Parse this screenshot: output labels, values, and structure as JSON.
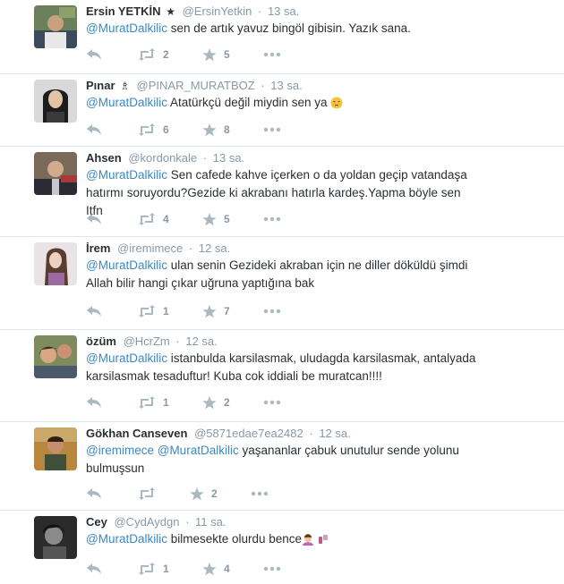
{
  "tweets": [
    {
      "name": "Ersin YETKİN",
      "badge": "★",
      "handle": "@ErsinYetkin",
      "time": "13 sa.",
      "mentions": [
        "@MuratDalkilic"
      ],
      "text": " sen de artık yavuz bingöl gibisin. Yazık sana.",
      "retweets": "2",
      "favorites": "5"
    },
    {
      "name": "Pınar",
      "badge": "♗",
      "handle": "@PINAR_MURATBOZ",
      "time": "13 sa.",
      "mentions": [
        "@MuratDalkilic"
      ],
      "text": " Atatürkçü değil miydin sen ya ",
      "emoji": "pensive-face-emoji",
      "retweets": "6",
      "favorites": "8"
    },
    {
      "name": "Ahsen",
      "handle": "@kordonkale",
      "time": "13 sa.",
      "mentions": [
        "@MuratDalkilic"
      ],
      "text": " Sen cafede kahve içerken o da yoldan geçip vatandaşa hatırmı soruyordu?Gezide ki akrabanı hatırla kardeş.Yapma böyle sen Itfn",
      "retweets": "4",
      "favorites": "5"
    },
    {
      "name": "İrem",
      "handle": "@iremimece",
      "time": "12 sa.",
      "mentions": [
        "@MuratDalkilic"
      ],
      "text": " ulan senin Gezideki akraban için ne diller döküldü şimdi Allah bilir hangi çıkar uğruna yaptığına bak",
      "retweets": "1",
      "favorites": "7"
    },
    {
      "name": "özüm",
      "handle": "@HcrZm",
      "time": "12 sa.",
      "mentions": [
        "@MuratDalkilic"
      ],
      "text": " istanbulda karsilasmak, uludagda karsilasmak, antalyada karsilasmak tesaduftur! Kuba cok iddiali be muratcan!!!!",
      "retweets": "1",
      "favorites": "2"
    },
    {
      "name": "Gökhan Canseven",
      "handle": "@5871edae7ea2482",
      "time": "12 sa.",
      "mentions": [
        "@iremimece",
        "@MuratDalkilic"
      ],
      "text": " yaşananlar çabuk unutulur sende yolunu bulmuşsun",
      "retweets": "",
      "favorites": "2"
    },
    {
      "name": "Cey",
      "handle": "@CydAydgn",
      "time": "11 sa.",
      "mentions": [
        "@MuratDalkilic"
      ],
      "text": " bilmesekte olurdu bence",
      "emoji": "woman-gesturing-and-nail-polish-emoji",
      "retweets": "1",
      "favorites": "4"
    }
  ],
  "icons": {
    "reply": "reply-icon",
    "retweet": "retweet-icon",
    "favorite": "star-icon",
    "more": "more-icon"
  },
  "colors": {
    "mention": "#3b88c3",
    "meta": "#8899a6",
    "action_icon": "#aab8c2",
    "divider": "#e1e8ed"
  }
}
